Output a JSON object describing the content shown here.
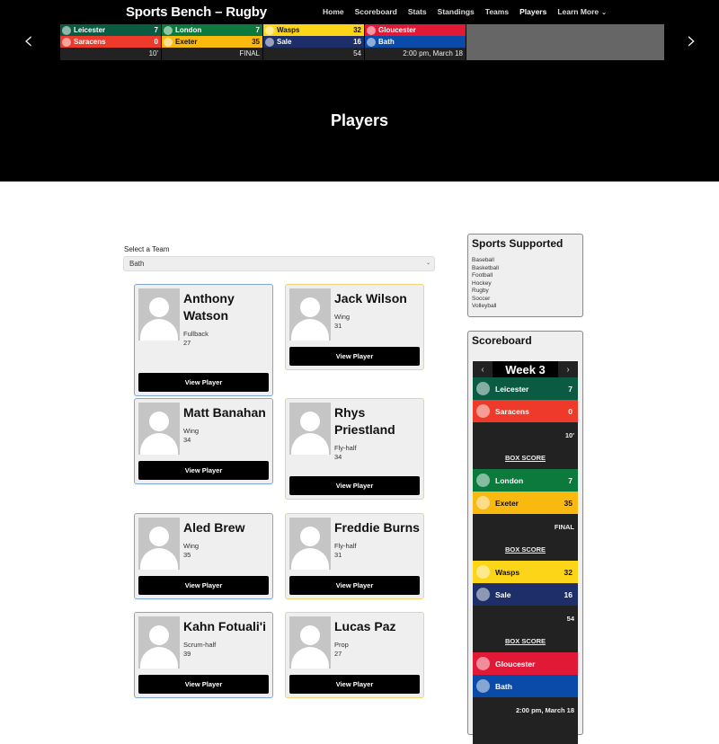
{
  "site": {
    "title": "Sports Bench – Rugby",
    "nav": [
      {
        "label": "Home"
      },
      {
        "label": "Scoreboard"
      },
      {
        "label": "Stats"
      },
      {
        "label": "Standings"
      },
      {
        "label": "Teams"
      },
      {
        "label": "Players",
        "active": true
      },
      {
        "label": "Learn More",
        "icon": "chevron-down-icon",
        "glyph": "⌄"
      }
    ]
  },
  "ticker": {
    "prev_icon": "‹",
    "next_icon": "›",
    "games": [
      {
        "home": {
          "name": "Leicester",
          "score": "7",
          "color": "#0b5b43"
        },
        "away": {
          "name": "Saracens",
          "score": "0",
          "color": "#ee3a2b"
        },
        "status": "10'"
      },
      {
        "home": {
          "name": "London",
          "score": "7",
          "color": "#0c7a3d"
        },
        "away": {
          "name": "Exeter",
          "score": "35",
          "color": "#f9b90f"
        },
        "status": "FINAL"
      },
      {
        "home": {
          "name": "Wasps",
          "score": "32",
          "color": "#fdd518"
        },
        "away": {
          "name": "Sale",
          "score": "16",
          "color": "#1d2e68"
        },
        "status": "54"
      },
      {
        "home": {
          "name": "Gloucester",
          "score": "",
          "color": "#e21837"
        },
        "away": {
          "name": "Bath",
          "score": "",
          "color": "#0a4aa8"
        },
        "status": "2:00 pm, March 18"
      }
    ]
  },
  "page": {
    "title": "Players"
  },
  "team_select": {
    "label": "Select a Team",
    "value": "Bath",
    "chevron": "⌄"
  },
  "players": [
    {
      "name": "Anthony Watson",
      "position": "Fullback",
      "number": "27",
      "button": "View Player"
    },
    {
      "name": "Jack Wilson",
      "position": "Wing",
      "number": "31",
      "button": "View Player"
    },
    {
      "name": "Matt Banahan",
      "position": "Wing",
      "number": "34",
      "button": "View Player"
    },
    {
      "name": "Rhys Priestland",
      "position": "Fly-half",
      "number": "34",
      "button": "View Player"
    },
    {
      "name": "Aled Brew",
      "position": "Wing",
      "number": "35",
      "button": "View Player"
    },
    {
      "name": "Freddie Burns",
      "position": "Fly-half",
      "number": "31",
      "button": "View Player"
    },
    {
      "name": "Kahn Fotuali'i",
      "position": "Scrum-half",
      "number": "39",
      "button": "View Player"
    },
    {
      "name": "Lucas Paz",
      "position": "Prop",
      "number": "27",
      "button": "View Player"
    }
  ],
  "sidebar": {
    "sports": {
      "title": "Sports Supported",
      "items": [
        "Baseball",
        "Basketball",
        "Football",
        "Hockey",
        "Rugby",
        "Soccer",
        "Volleyball"
      ]
    },
    "scoreboard": {
      "title": "Scoreboard",
      "week": "Week 3",
      "prev": "‹",
      "next": "›",
      "box_score_label": "BOX SCORE",
      "games": [
        {
          "home": {
            "name": "Leicester",
            "score": "7",
            "color": "#0b5b43"
          },
          "away": {
            "name": "Saracens",
            "score": "0",
            "color": "#ee3a2b"
          },
          "status": "10'"
        },
        {
          "home": {
            "name": "London",
            "score": "7",
            "color": "#0c7a3d"
          },
          "away": {
            "name": "Exeter",
            "score": "35",
            "color": "#f9b90f"
          },
          "status": "FINAL"
        },
        {
          "home": {
            "name": "Wasps",
            "score": "32",
            "color": "#fdd518"
          },
          "away": {
            "name": "Sale",
            "score": "16",
            "color": "#1d2e68"
          },
          "status": "54"
        },
        {
          "home": {
            "name": "Gloucester",
            "score": "",
            "color": "#e21837"
          },
          "away": {
            "name": "Bath",
            "score": "",
            "color": "#0a4aa8"
          },
          "status": "2:00 pm, March 18"
        }
      ]
    }
  }
}
